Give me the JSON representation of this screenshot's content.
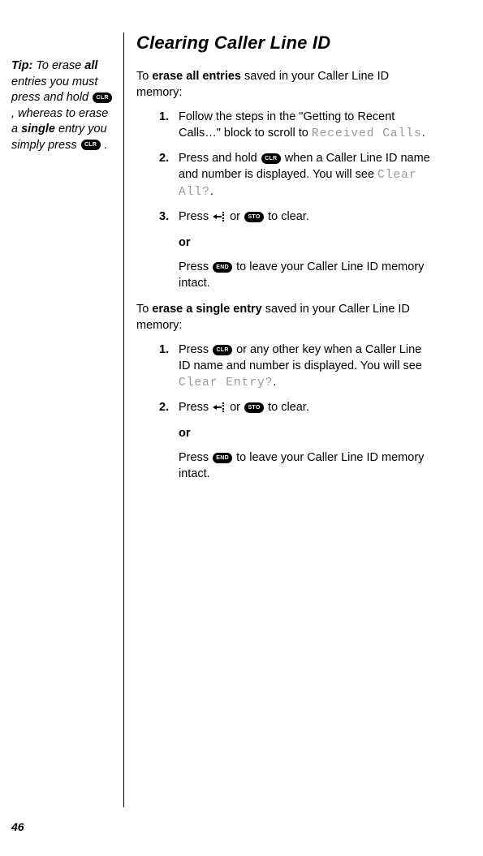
{
  "page_number": "46",
  "title": "Clearing Caller Line ID",
  "tip": {
    "label": "Tip:",
    "seg1": " To erase ",
    "seg2_bold": "all",
    "seg3": " entries you must press and hold ",
    "key1": "CLR",
    "seg4": " , whereas to erase a ",
    "seg5_bold": "single",
    "seg6": " entry you simply press ",
    "key2": "CLR",
    "seg7": " ."
  },
  "intro1": {
    "pre": "To ",
    "bold": "erase all entries",
    "post": " saved in your Caller Line ID memory:"
  },
  "list1": {
    "i1": {
      "num": "1.",
      "a": "Follow the steps in the \"Getting to Recent Calls…\" block to scroll to ",
      "screen": "Received Calls",
      "b": "."
    },
    "i2": {
      "num": "2.",
      "a": "Press and hold ",
      "key": "CLR",
      "b": " when a Caller Line ID name and number is displayed. You will see ",
      "screen": "Clear All?",
      "c": "."
    },
    "i3": {
      "num": "3.",
      "a": "Press ",
      "b": " or ",
      "key": "STO",
      "c": " to clear."
    }
  },
  "or1": {
    "or": "or",
    "a": "Press ",
    "key": "END",
    "b": " to leave your Caller Line ID memory intact."
  },
  "intro2": {
    "pre": "To ",
    "bold": "erase a single entry",
    "post": " saved in your Caller Line ID memory:"
  },
  "list2": {
    "i1": {
      "num": "1.",
      "a": "Press ",
      "key": "CLR",
      "b": " or any other key when a Caller Line ID name and number is displayed. You will see ",
      "screen": "Clear Entry?",
      "c": "."
    },
    "i2": {
      "num": "2.",
      "a": "Press ",
      "b": " or ",
      "key": "STO",
      "c": " to clear."
    }
  },
  "or2": {
    "or": "or",
    "a": "Press ",
    "key": "END",
    "b": " to leave your Caller Line ID memory intact."
  }
}
